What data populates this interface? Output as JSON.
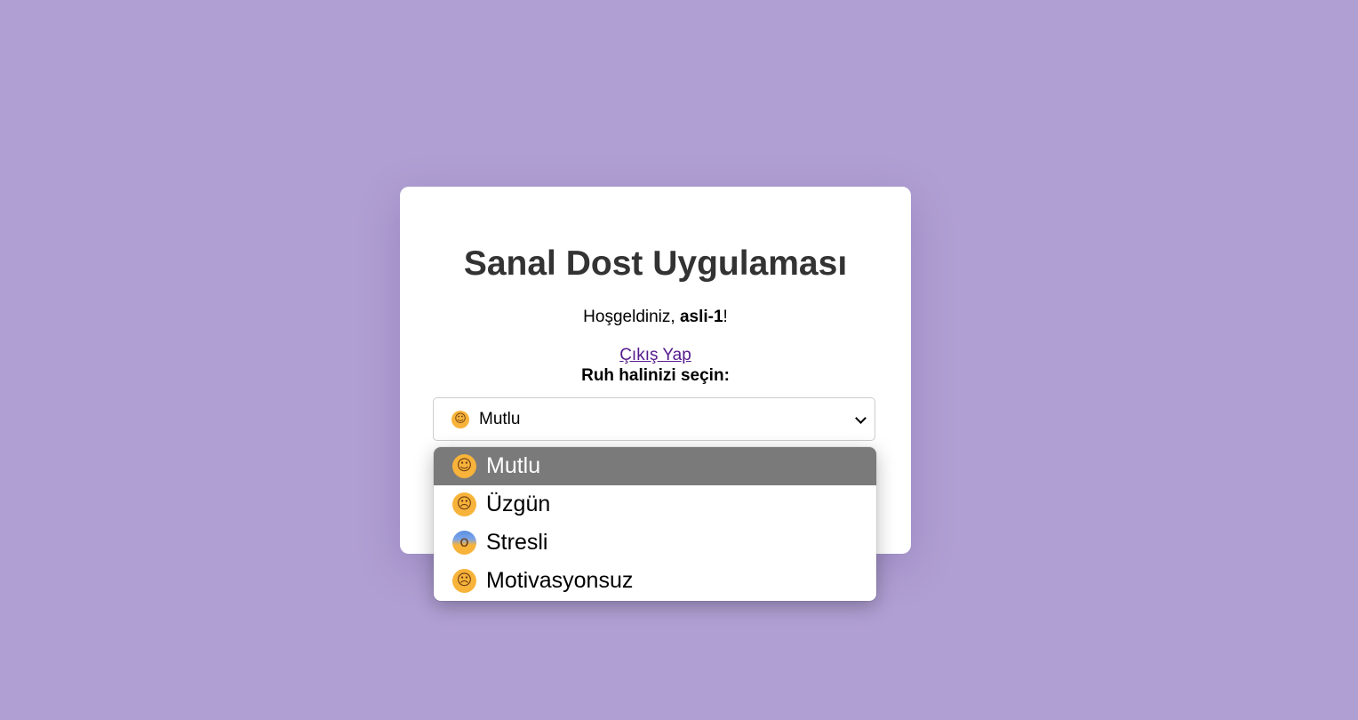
{
  "app": {
    "title": "Sanal Dost Uygulaması"
  },
  "welcome": {
    "prefix": "Hoşgeldiniz, ",
    "username": "asli-1",
    "suffix": "!"
  },
  "logout_label": "Çıkış Yap",
  "mood": {
    "label": "Ruh halinizi seçin:",
    "selected": "Mutlu",
    "selected_icon": "smiling-face-icon",
    "options": [
      {
        "label": "Mutlu",
        "icon": "smiling-face-icon",
        "selected": true
      },
      {
        "label": "Üzgün",
        "icon": "crying-face-icon",
        "selected": false
      },
      {
        "label": "Stresli",
        "icon": "screaming-face-icon",
        "selected": false
      },
      {
        "label": "Motivasyonsuz",
        "icon": "frowning-face-icon",
        "selected": false
      }
    ]
  },
  "colors": {
    "background": "#b09fd3",
    "card": "#ffffff",
    "title": "#333333",
    "link": "#551a8b",
    "option_highlight": "#7a7a7a"
  }
}
